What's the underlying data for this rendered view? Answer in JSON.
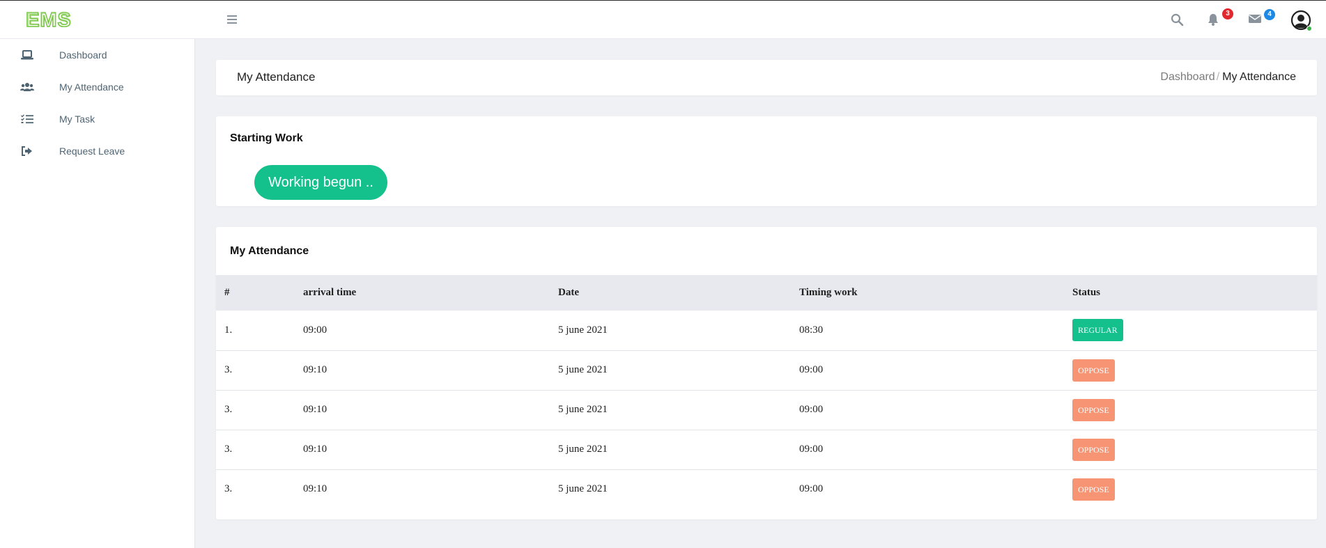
{
  "app": {
    "logo_text": "EMS",
    "logo_color": "#7dc84a"
  },
  "header": {
    "notifications_count": "3",
    "messages_count": "4",
    "notif_badge_color": "#e0282e",
    "msg_badge_color": "#1e88e5",
    "online_color": "#3fb24a"
  },
  "sidebar": {
    "items": [
      {
        "label": "Dashboard",
        "icon": "laptop-icon"
      },
      {
        "label": "My Attendance",
        "icon": "users-icon"
      },
      {
        "label": "My Task",
        "icon": "tasks-icon"
      },
      {
        "label": "Request Leave",
        "icon": "sign-out-icon"
      }
    ]
  },
  "page": {
    "title": "My Attendance",
    "breadcrumb": [
      "Dashboard",
      "/",
      "My Attendance"
    ]
  },
  "starting_work": {
    "title": "Starting Work",
    "button_label": "Working begun ..",
    "button_color": "#14c08c"
  },
  "attendance": {
    "title": "My Attendance",
    "columns": [
      "#",
      "arrival time",
      "Date",
      "Timing work",
      "Status"
    ],
    "rows": [
      {
        "num": "1.",
        "arrival": "09:00",
        "date": "5 june 2021",
        "timing": "08:30",
        "status": "REGULAR",
        "status_color": "#14c08c"
      },
      {
        "num": "3.",
        "arrival": "09:10",
        "date": "5 june 2021",
        "timing": "09:00",
        "status": "OPPOSE",
        "status_color": "#f79474"
      },
      {
        "num": "3.",
        "arrival": "09:10",
        "date": "5 june 2021",
        "timing": "09:00",
        "status": "OPPOSE",
        "status_color": "#f79474"
      },
      {
        "num": "3.",
        "arrival": "09:10",
        "date": "5 june 2021",
        "timing": "09:00",
        "status": "OPPOSE",
        "status_color": "#f79474"
      },
      {
        "num": "3.",
        "arrival": "09:10",
        "date": "5 june 2021",
        "timing": "09:00",
        "status": "OPPOSE",
        "status_color": "#f79474"
      }
    ]
  }
}
